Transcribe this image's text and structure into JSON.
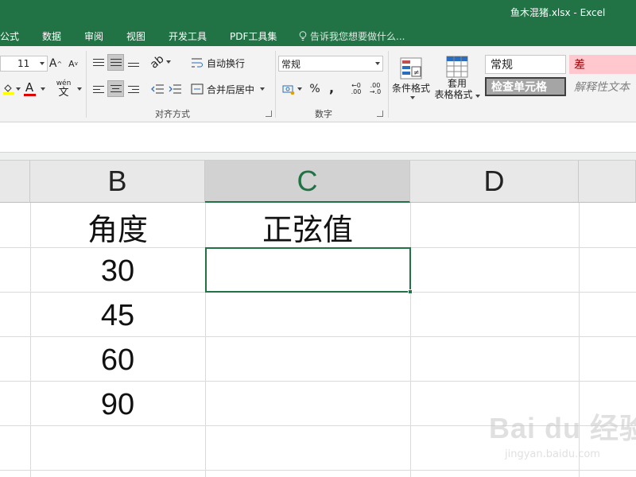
{
  "window": {
    "title": "鱼木混猪.xlsx - Excel"
  },
  "tabs": [
    {
      "label": "公式"
    },
    {
      "label": "数据"
    },
    {
      "label": "审阅"
    },
    {
      "label": "视图"
    },
    {
      "label": "开发工具"
    },
    {
      "label": "PDF工具集"
    }
  ],
  "tell_me": {
    "placeholder": "告诉我您想要做什么..."
  },
  "ribbon": {
    "font_size": "11",
    "wrap_text": "自动换行",
    "merge_center": "合并后居中",
    "number_format": "常规",
    "percent": "%",
    "comma": ",",
    "conditional_format": "条件格式",
    "table_format_line1": "套用",
    "table_format_line2": "表格格式",
    "alignment_label": "对齐方式",
    "number_label": "数字",
    "phonetic": "wén"
  },
  "styles": {
    "normal": "常规",
    "bad": "差",
    "check_cell": "检查单元格",
    "explanatory": "解释性文本"
  },
  "columns": [
    {
      "letter": "B"
    },
    {
      "letter": "C"
    },
    {
      "letter": "D"
    }
  ],
  "cells": {
    "B_header": "角度",
    "C_header": "正弦值",
    "B_values": [
      "30",
      "45",
      "60",
      "90"
    ]
  },
  "watermark": {
    "text": "Bai du 经验",
    "sub": "jingyan.baidu.com"
  },
  "colors": {
    "excel_green": "#217346",
    "bad_style_bg": "#ffc7ce",
    "bad_style_text": "#9c0006"
  }
}
